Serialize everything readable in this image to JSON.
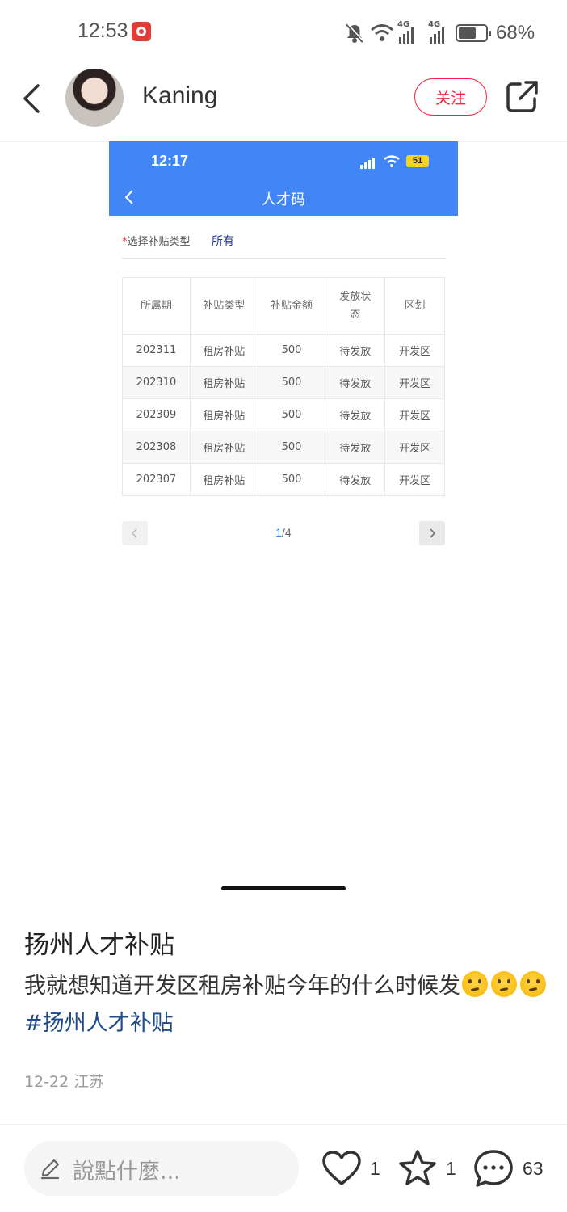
{
  "status_bar": {
    "time": "12:53",
    "network_1": "4G",
    "network_2": "4G",
    "battery": "68%",
    "battery_level": 0.68
  },
  "header": {
    "username": "Kaning",
    "follow_label": "关注"
  },
  "embedded_screenshot": {
    "status_time": "12:17",
    "battery": "51",
    "title": "人才码",
    "filter": {
      "required_mark": "*",
      "label": "选择补贴类型",
      "value": "所有"
    },
    "table": {
      "headers": [
        "所属期",
        "补贴类型",
        "补贴金额",
        "发放状\n态",
        "区划"
      ],
      "rows": [
        [
          "202311",
          "租房补贴",
          "500",
          "待发放",
          "开发区"
        ],
        [
          "202310",
          "租房补贴",
          "500",
          "待发放",
          "开发区"
        ],
        [
          "202309",
          "租房补贴",
          "500",
          "待发放",
          "开发区"
        ],
        [
          "202308",
          "租房补贴",
          "500",
          "待发放",
          "开发区"
        ],
        [
          "202307",
          "租房补贴",
          "500",
          "待发放",
          "开发区"
        ]
      ]
    },
    "pager": {
      "current": "1",
      "total": "/4"
    }
  },
  "post": {
    "title": "扬州人才补贴",
    "body": "我就想知道开发区租房补贴今年的什么时候发",
    "hashtag": "#扬州人才补贴",
    "date": "12-22",
    "location": "江苏"
  },
  "bottom_bar": {
    "comment_placeholder": "說點什麼...",
    "likes": "1",
    "collects": "1",
    "comments": "63"
  }
}
